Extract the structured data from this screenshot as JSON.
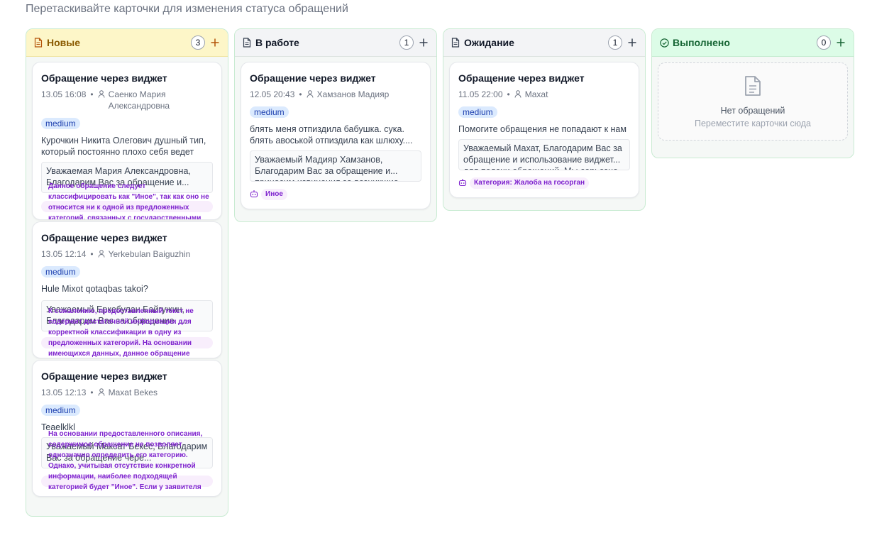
{
  "hint": "Перетаскивайте карточки для изменения статуса обращений",
  "columns": {
    "new": {
      "title": "Новые",
      "count": "3",
      "cards": [
        {
          "title": "Обращение через виджет",
          "date": "13.05 16:08",
          "author": "Саенко Мария Александровна",
          "priority": "medium",
          "description": "Курочкин Никита Олегович душный тип, который постоянно плохо себя ведет",
          "reply": "Уважаемая Мария Александровна, Благодарим Вас за обращение и...",
          "category": "Данное обращение следует классифицировать как \"Иное\", так как оно не относится ни к одной из предложенных категорий, связанных с государственными"
        },
        {
          "title": "Обращение через виджет",
          "date": "13.05 12:14",
          "author": "Yerkebulan Baiguzhin",
          "priority": "medium",
          "description": "Hule Mixot qotaqbas takoi?",
          "reply": "Уважаемый Еркебулан Байгужин, Благодарим Вас за обращение. ...",
          "category": "К сожалению, предоставленный текст не содержит достаточной информации для корректной классификации в одну из предложенных категорий. На основании имеющихся данных, данное обращение"
        },
        {
          "title": "Обращение через виджет",
          "date": "13.05 12:13",
          "author": "Maxat Bekes",
          "priority": "medium",
          "description": "Teaelklkl",
          "reply": "Уважаемый Максат Бекес, Благодарим Вас за обращение чере...",
          "category": "На основании предоставленного описания, содержимое обращение не позволяет однозначно определить его категорию. Однако, учитывая отсутствие конкретной информации, наиболее подходящей категорией будет \"Иное\". Если у заявителя"
        }
      ]
    },
    "work": {
      "title": "В работе",
      "count": "1",
      "cards": [
        {
          "title": "Обращение через виджет",
          "date": "12.05 20:43",
          "author": "Хамзанов Мадияр",
          "priority": "medium",
          "description": "блять меня отпиздила бабушка. сука. блять авоськой отпиздила как шлюху....",
          "reply": "Уважаемый Мадияр Хамзанов, Благодарим Вас за обращение и... приносим извинения за возникшие",
          "category": "Иное"
        }
      ]
    },
    "wait": {
      "title": "Ожидание",
      "count": "1",
      "cards": [
        {
          "title": "Обращение через виджет",
          "date": "11.05 22:00",
          "author": "Maxat",
          "priority": "medium",
          "description": "Помогите обращения не попадают к нам",
          "reply": "Уважаемый Махат, Благодарим Вас за обращение и использование виджет... для подачи обращений. Мы серьезно",
          "category": "Категория: Жалоба на госорган"
        }
      ]
    },
    "done": {
      "title": "Выполнено",
      "count": "0",
      "empty_title": "Нет обращений",
      "empty_sub": "Переместите карточки сюда"
    }
  }
}
